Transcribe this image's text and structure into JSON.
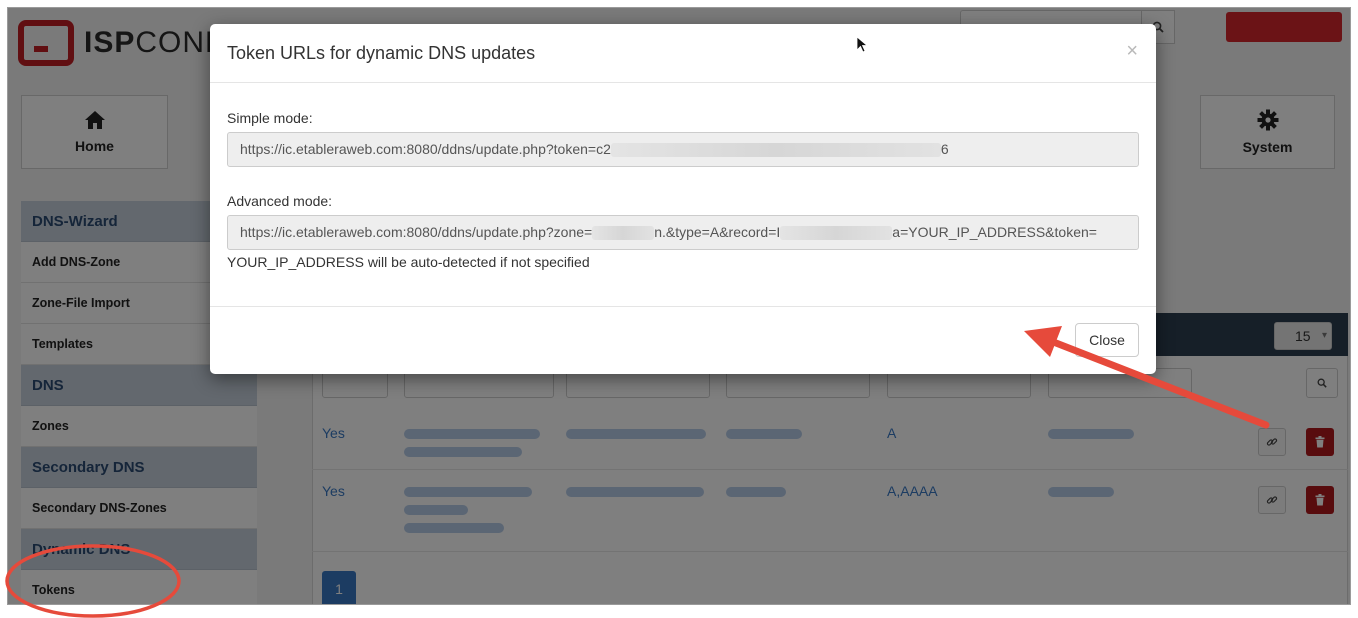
{
  "app": {
    "logo_bold": "ISP",
    "logo_light": "CONF"
  },
  "topnav": {
    "home_label": "Home",
    "system_label": "System",
    "home_icon": "home-icon",
    "system_icon": "gear-icon"
  },
  "sidebar": {
    "sections": [
      {
        "title": "DNS-Wizard",
        "items": [
          "Add DNS-Zone",
          "Zone-File Import",
          "Templates"
        ]
      },
      {
        "title": "DNS",
        "items": [
          "Zones"
        ]
      },
      {
        "title": "Secondary DNS",
        "items": [
          "Secondary DNS-Zones"
        ]
      },
      {
        "title": "Dynamic DNS",
        "items": [
          "Tokens"
        ]
      }
    ]
  },
  "list": {
    "per_page": "15",
    "rows": [
      {
        "active": "Yes",
        "type": "A"
      },
      {
        "active": "Yes",
        "type": "A,AAAA"
      }
    ],
    "page": "1"
  },
  "modal": {
    "title": "Token URLs for dynamic DNS updates",
    "close_x": "×",
    "simple_label": "Simple mode:",
    "simple_url_prefix": "https://ic.etableraweb.com:8080/ddns/update.php?token=c2",
    "simple_url_suffix": "6",
    "advanced_label": "Advanced mode:",
    "advanced_url_part1": "https://ic.etableraweb.com:8080/ddns/update.php?zone=",
    "advanced_url_part2": "n.&type=A&record=I",
    "advanced_url_part3": "a=YOUR_IP_ADDRESS&token=",
    "help_text": "YOUR_IP_ADDRESS will be auto-detected if not specified",
    "close_button": "Close"
  },
  "colors": {
    "brand_red": "#c21f24",
    "link_blue": "#3978c4",
    "annotation_red": "#e64a3b"
  }
}
